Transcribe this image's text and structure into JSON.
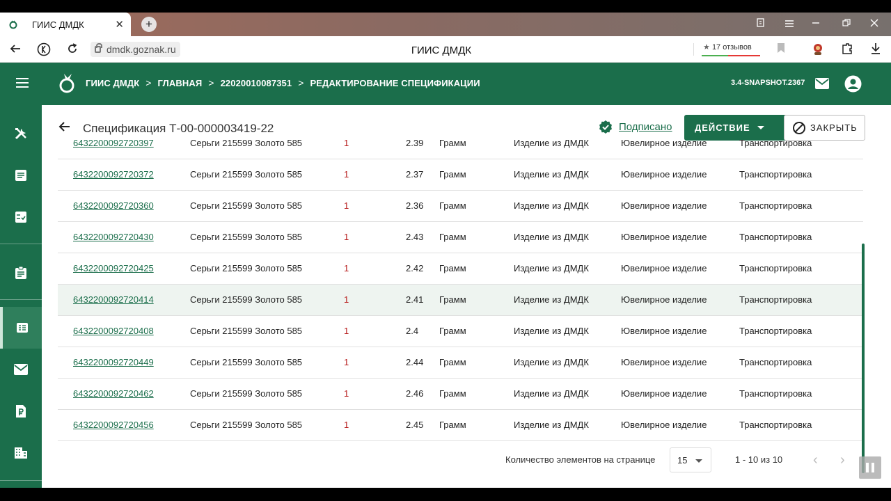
{
  "browser": {
    "tab_title": "ГИИС ДМДК",
    "tab_close": "✕",
    "new_tab": "+",
    "url": "dmdk.goznak.ru",
    "page_title": "ГИИС ДМДК",
    "reviews": "17 отзывов",
    "reviews_star": "★"
  },
  "header": {
    "breadcrumbs": [
      "ГИИС ДМДК",
      "ГЛАВНАЯ",
      "22020010087351",
      "РЕДАКТИРОВАНИЕ СПЕЦИФИКАЦИИ"
    ],
    "breadcrumb_sep": ">",
    "version": "3.4-SNAPSHOT.2367"
  },
  "page": {
    "title": "Спецификация Т-00-000003419-22",
    "status": "Подписано",
    "action_button": "ДЕЙСТВИЕ",
    "close_button": "ЗАКРЫТЬ"
  },
  "colors": {
    "brand": "#1b6e4b",
    "row_highlight": "#eef4f0",
    "qty_red": "#b71c1c"
  },
  "table": {
    "rows": [
      {
        "code": "6432200092720397",
        "name": "Серьги 215599 Золото 585",
        "qty": "1",
        "weight": "2.39",
        "unit": "Грамм",
        "type": "Изделие из ДМДК",
        "category": "Ювелирное изделие",
        "status": "Транспортировка"
      },
      {
        "code": "6432200092720372",
        "name": "Серьги 215599 Золото 585",
        "qty": "1",
        "weight": "2.37",
        "unit": "Грамм",
        "type": "Изделие из ДМДК",
        "category": "Ювелирное изделие",
        "status": "Транспортировка"
      },
      {
        "code": "6432200092720360",
        "name": "Серьги 215599 Золото 585",
        "qty": "1",
        "weight": "2.36",
        "unit": "Грамм",
        "type": "Изделие из ДМДК",
        "category": "Ювелирное изделие",
        "status": "Транспортировка"
      },
      {
        "code": "6432200092720430",
        "name": "Серьги 215599 Золото 585",
        "qty": "1",
        "weight": "2.43",
        "unit": "Грамм",
        "type": "Изделие из ДМДК",
        "category": "Ювелирное изделие",
        "status": "Транспортировка"
      },
      {
        "code": "6432200092720425",
        "name": "Серьги 215599 Золото 585",
        "qty": "1",
        "weight": "2.42",
        "unit": "Грамм",
        "type": "Изделие из ДМДК",
        "category": "Ювелирное изделие",
        "status": "Транспортировка"
      },
      {
        "code": "6432200092720414",
        "name": "Серьги 215599 Золото 585",
        "qty": "1",
        "weight": "2.41",
        "unit": "Грамм",
        "type": "Изделие из ДМДК",
        "category": "Ювелирное изделие",
        "status": "Транспортировка",
        "highlighted": true
      },
      {
        "code": "6432200092720408",
        "name": "Серьги 215599 Золото 585",
        "qty": "1",
        "weight": "2.4",
        "unit": "Грамм",
        "type": "Изделие из ДМДК",
        "category": "Ювелирное изделие",
        "status": "Транспортировка"
      },
      {
        "code": "6432200092720449",
        "name": "Серьги 215599 Золото 585",
        "qty": "1",
        "weight": "2.44",
        "unit": "Грамм",
        "type": "Изделие из ДМДК",
        "category": "Ювелирное изделие",
        "status": "Транспортировка"
      },
      {
        "code": "6432200092720462",
        "name": "Серьги 215599 Золото 585",
        "qty": "1",
        "weight": "2.46",
        "unit": "Грамм",
        "type": "Изделие из ДМДК",
        "category": "Ювелирное изделие",
        "status": "Транспортировка"
      },
      {
        "code": "6432200092720456",
        "name": "Серьги 215599 Золото 585",
        "qty": "1",
        "weight": "2.45",
        "unit": "Грамм",
        "type": "Изделие из ДМДК",
        "category": "Ювелирное изделие",
        "status": "Транспортировка"
      }
    ]
  },
  "paginator": {
    "items_per_page_label": "Количество элементов на странице",
    "page_size": "15",
    "range": "1 - 10 из 10",
    "prev": "‹",
    "next": "›"
  },
  "sidebar": {
    "items": [
      "tools-icon",
      "list-icon",
      "checklist-icon",
      "clipboard-icon",
      "specification-icon",
      "mail-icon",
      "ruble-document-icon",
      "buildings-icon"
    ]
  }
}
